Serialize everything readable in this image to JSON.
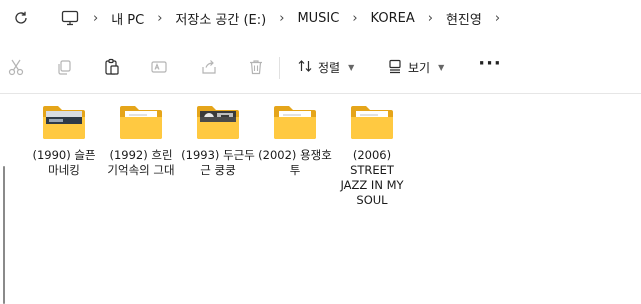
{
  "address_bar": {
    "root_icon": "computer-icon",
    "separator": "›",
    "breadcrumbs": [
      "내 PC",
      "저장소 공간 (E:)",
      "MUSIC",
      "KOREA",
      "현진영"
    ]
  },
  "toolbar": {
    "sort_label": "정렬",
    "view_label": "보기",
    "more_label": "···"
  },
  "folders": [
    {
      "name": "(1990) 슬픈 마네킹",
      "thumb": "cover-art"
    },
    {
      "name": "(1992) 흐린 기억속의 그대",
      "thumb": "document"
    },
    {
      "name": "(1993) 두근두근 쿵쿵",
      "thumb": "cover-art"
    },
    {
      "name": "(2002) 용쟁호투",
      "thumb": "document"
    },
    {
      "name": "(2006) STREET JAZZ IN MY SOUL",
      "thumb": "document"
    }
  ],
  "colors": {
    "folder_back": "#e5a51a",
    "folder_front": "#ffc941",
    "icon_disabled": "#b4b4b4",
    "icon_active": "#2b2b2b"
  }
}
